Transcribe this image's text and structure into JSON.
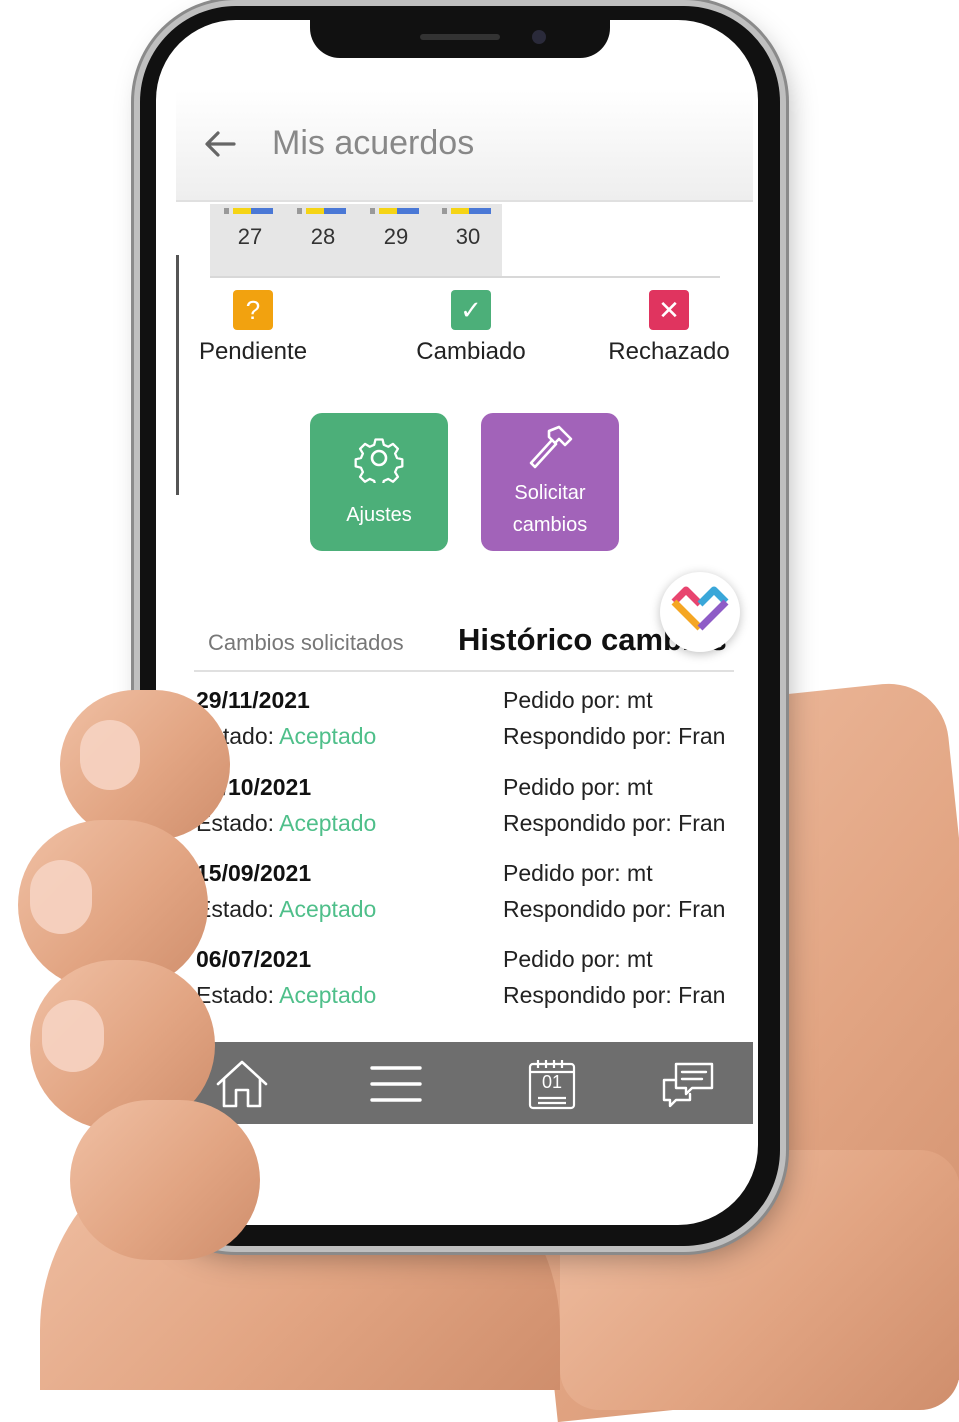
{
  "header": {
    "title": "Mis acuerdos"
  },
  "calendar": {
    "days": [
      "27",
      "28",
      "29",
      "30"
    ]
  },
  "legend": [
    {
      "label": "Pendiente",
      "glyph": "?",
      "color": "#f2a20f"
    },
    {
      "label": "Cambiado",
      "glyph": "✓",
      "color": "#4caf79"
    },
    {
      "label": "Rechazado",
      "glyph": "✕",
      "color": "#e0345f"
    }
  ],
  "actions": {
    "settings_label": "Ajustes",
    "request_label_line1": "Solicitar",
    "request_label_line2": "cambios"
  },
  "tabs": {
    "requested": "Cambios solicitados",
    "history": "Histórico cambios"
  },
  "history": [
    {
      "date": "29/11/2021",
      "status_label": "Estado:",
      "status": "Aceptado",
      "requested_by": "Pedido por: mt",
      "responded_by": "Respondido por: Fran"
    },
    {
      "date": "03/10/2021",
      "status_label": "Estado:",
      "status": "Aceptado",
      "requested_by": "Pedido por: mt",
      "responded_by": "Respondido por: Fran"
    },
    {
      "date": "15/09/2021",
      "status_label": "Estado:",
      "status": "Aceptado",
      "requested_by": "Pedido por: mt",
      "responded_by": "Respondido por: Fran"
    },
    {
      "date": "06/07/2021",
      "status_label": "Estado:",
      "status": "Aceptado",
      "requested_by": "Pedido por: mt",
      "responded_by": "Respondido por: Fran"
    }
  ],
  "nav": {
    "calendar_icon_text": "01",
    "icons": [
      "home-icon",
      "menu-icon",
      "calendar-icon",
      "chat-icon"
    ]
  },
  "colors": {
    "accepted": "#4fbf8a",
    "settings_tile": "#4caf79",
    "request_tile": "#a263b9",
    "nav_bar": "#6e6e6e"
  }
}
